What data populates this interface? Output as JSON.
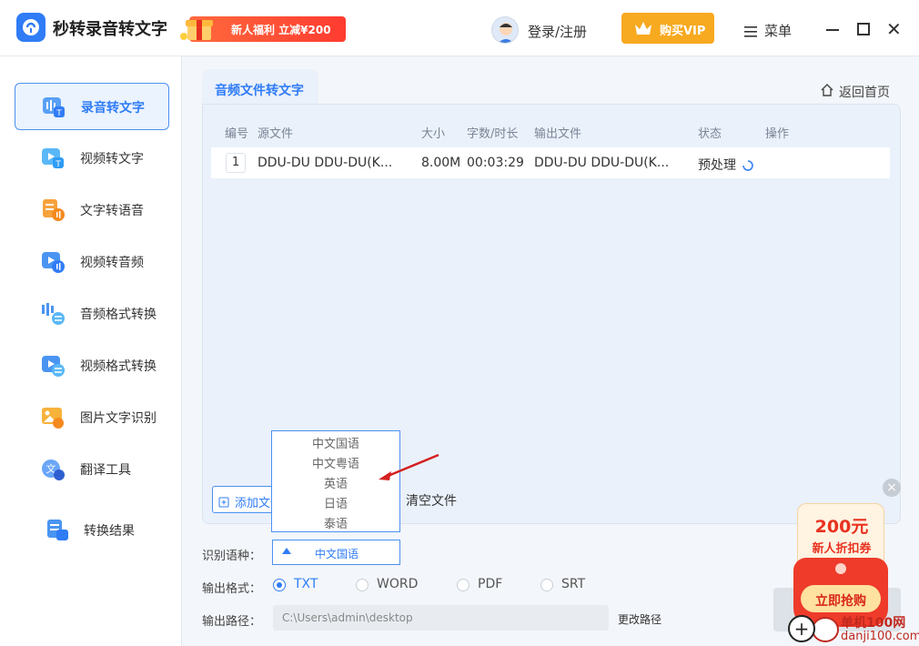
{
  "app": {
    "title": "秒转录音转文字"
  },
  "header": {
    "promo_text": "新人福利 立减¥200",
    "login_label": "登录/注册",
    "vip_label": "购买VIP",
    "menu_label": "菜单"
  },
  "sidebar": {
    "items": [
      {
        "label": "录音转文字"
      },
      {
        "label": "视频转文字"
      },
      {
        "label": "文字转语音"
      },
      {
        "label": "视频转音频"
      },
      {
        "label": "音频格式转换"
      },
      {
        "label": "视频格式转换"
      },
      {
        "label": "图片文字识别"
      },
      {
        "label": "翻译工具"
      },
      {
        "label": "转换结果"
      }
    ]
  },
  "main": {
    "tab_label": "音频文件转文字",
    "home_label": "返回首页",
    "columns": [
      "编号",
      "源文件",
      "大小",
      "字数/时长",
      "输出文件",
      "状态",
      "操作"
    ],
    "rows": [
      {
        "num": "1",
        "source": "DDU-DU DDU-DU(K...",
        "size": "8.00M",
        "duration": "00:03:29",
        "output": "DDU-DU DDU-DU(K...",
        "status": "预处理"
      }
    ],
    "add_label": "添加文件",
    "clear_label": "清空文件"
  },
  "dropdown": {
    "options": [
      "中文国语",
      "中文粤语",
      "英语",
      "日语",
      "泰语"
    ]
  },
  "settings": {
    "lang_label": "识别语种：",
    "lang_value": "中文国语",
    "format_label": "输出格式：",
    "formats": [
      "TXT",
      "WORD",
      "PDF",
      "SRT"
    ],
    "selected_format": "TXT",
    "path_label": "输出路径：",
    "path_value": "C:\\Users\\admin\\desktop",
    "change_path_label": "更改路径"
  },
  "coupon": {
    "amount": "200元",
    "desc": "新人折扣券",
    "button": "立即抢购"
  },
  "watermark": {
    "line1": "单机100网",
    "line2": "danji100.com"
  },
  "colors": {
    "accent": "#2f7cf6",
    "vip": "#f7a91f",
    "promo": "#ff3b30"
  }
}
